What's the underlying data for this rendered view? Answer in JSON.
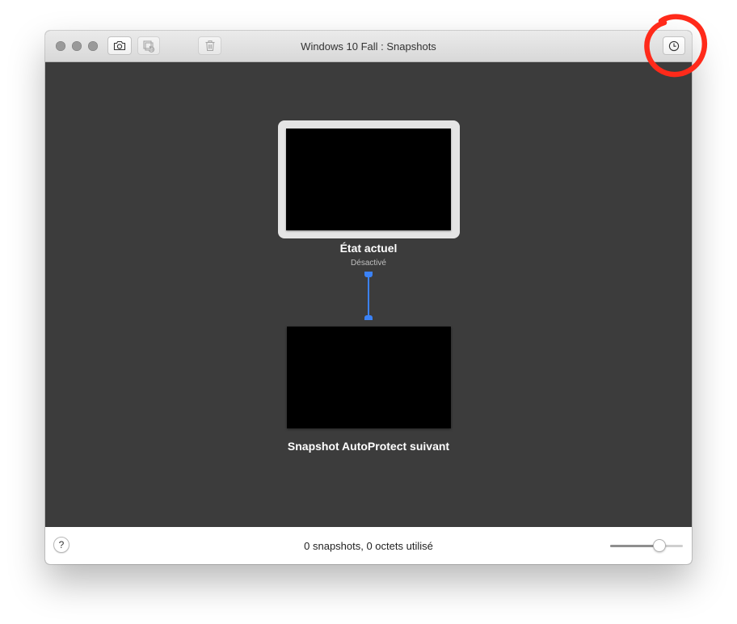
{
  "window": {
    "title": "Windows 10 Fall : Snapshots"
  },
  "toolbar": {
    "buttons": [
      {
        "name": "take-snapshot",
        "icon": "camera-icon"
      },
      {
        "name": "restore-snapshot",
        "icon": "restore-icon",
        "disabled": true
      },
      {
        "name": "delete-snapshot",
        "icon": "trash-icon",
        "disabled": true
      },
      {
        "name": "autoprotect",
        "icon": "clock-icon"
      }
    ]
  },
  "tree": {
    "current_state": {
      "label": "État actuel",
      "status": "Désactivé"
    },
    "next_snapshot": {
      "label": "Snapshot AutoProtect suivant"
    }
  },
  "footer": {
    "help_label": "?",
    "status": "0 snapshots, 0 octets utilisé",
    "zoom_level": 0.68
  },
  "colors": {
    "connector": "#3b82f6",
    "background": "#3c3c3c",
    "annotation": "#ff2a1a"
  },
  "annotation": {
    "shape": "hand-drawn circle",
    "target": "clock-icon"
  }
}
